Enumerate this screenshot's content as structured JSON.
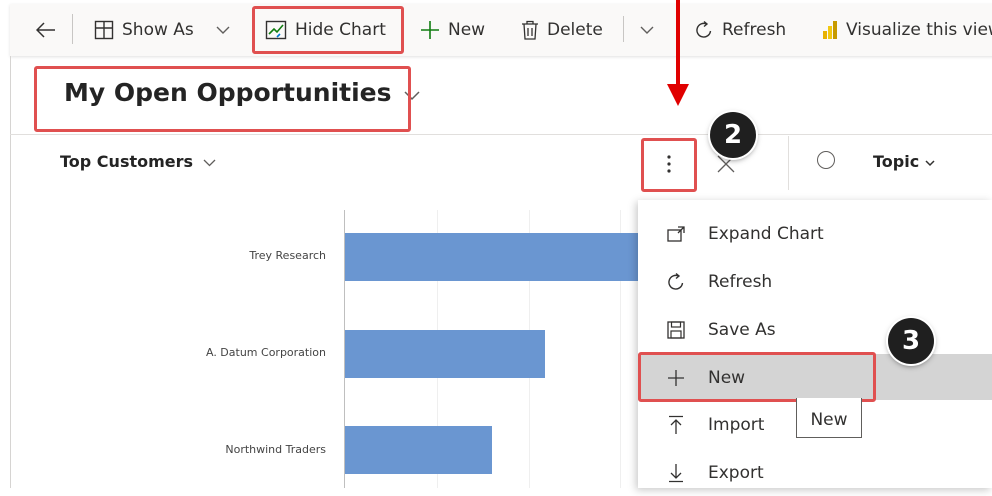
{
  "toolbar": {
    "show_as_label": "Show As",
    "hide_chart_label": "Hide Chart",
    "new_label": "New",
    "delete_label": "Delete",
    "refresh_label": "Refresh",
    "visualize_label": "Visualize this view"
  },
  "view": {
    "title": "My Open Opportunities"
  },
  "chart": {
    "selector_label": "Top Customers"
  },
  "chart_data": {
    "type": "bar",
    "orientation": "horizontal",
    "categories": [
      "Trey Research",
      "A. Datum Corporation",
      "Northwind Traders"
    ],
    "values": [
      100,
      67.6,
      49.8
    ]
  },
  "grid": {
    "column_topic": "Topic"
  },
  "chart_menu": {
    "items": [
      {
        "label": "Expand Chart",
        "icon": "expand-icon"
      },
      {
        "label": "Refresh",
        "icon": "refresh-icon"
      },
      {
        "label": "Save As",
        "icon": "save-icon"
      },
      {
        "label": "New",
        "icon": "plus-icon"
      },
      {
        "label": "Import",
        "icon": "import-icon"
      },
      {
        "label": "Export",
        "icon": "export-icon"
      }
    ],
    "tooltip": "New"
  },
  "annotations": {
    "step2": "2",
    "step3": "3"
  },
  "colors": {
    "highlight_box": "#e05050",
    "arrow": "#e00000",
    "bar": "#6a96d1",
    "menu_hover": "#d4d4d4"
  }
}
